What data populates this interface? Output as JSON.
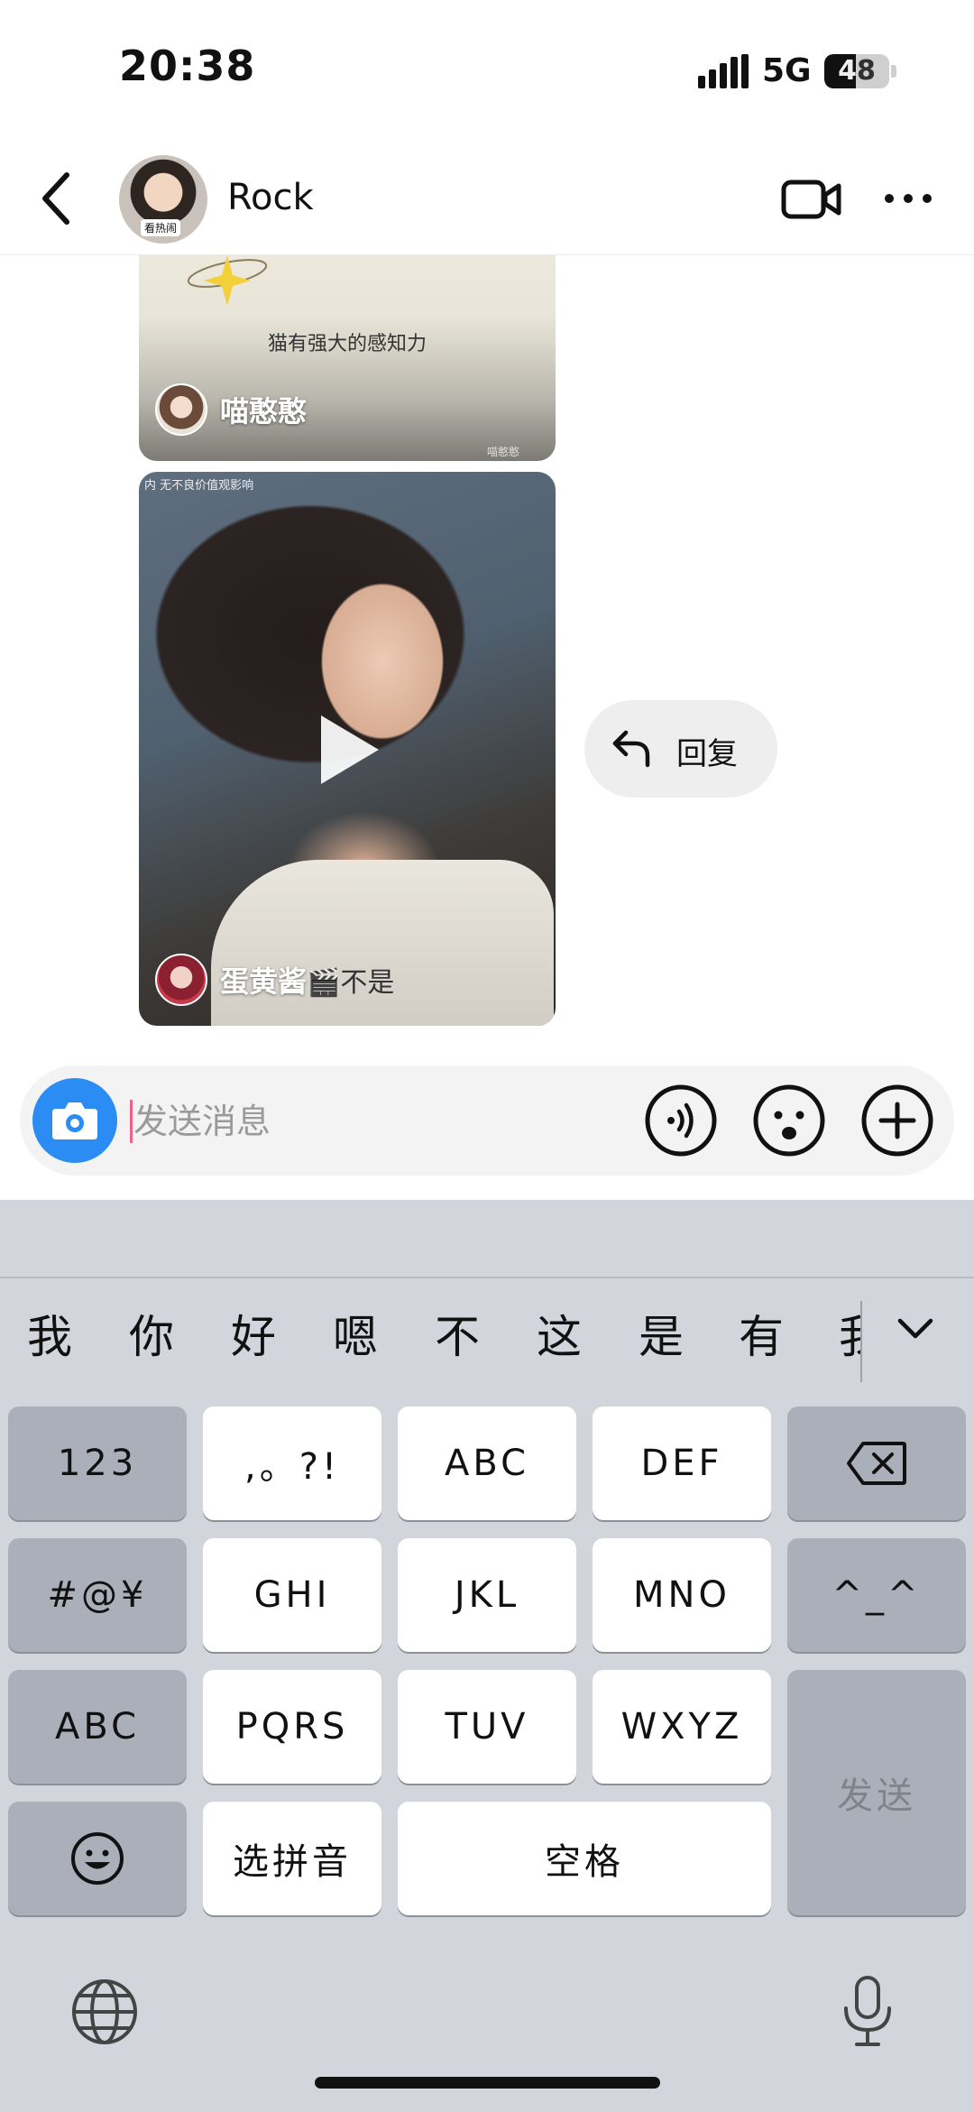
{
  "status_bar": {
    "time": "20:38",
    "network": "5G",
    "battery": "48",
    "battery_level": 0.48
  },
  "header": {
    "contact_name": "Rock",
    "avatar_tag": "看热闹"
  },
  "messages": [
    {
      "type": "video-card",
      "caption": "猫有强大的感知力",
      "author": "喵憨憨",
      "watermark": "喵憨憨"
    },
    {
      "type": "video-card",
      "notice": "内 无不良价值观影响",
      "author": "蛋黄酱",
      "author_suffix": "🎬不是"
    }
  ],
  "reply": {
    "label": "回复"
  },
  "composer": {
    "placeholder": "发送消息"
  },
  "keyboard": {
    "candidates": [
      "我",
      "你",
      "好",
      "嗯",
      "不",
      "这",
      "是",
      "有",
      "我"
    ],
    "rows": [
      [
        "123",
        ",。?!",
        "ABC",
        "DEF"
      ],
      [
        "#@¥",
        "GHI",
        "JKL",
        "MNO",
        "^_^"
      ],
      [
        "ABC",
        "PQRS",
        "TUV",
        "WXYZ"
      ],
      [
        "选拼音",
        "空格"
      ]
    ],
    "send_label": "发送"
  },
  "colors": {
    "accent": "#2b8df4",
    "caret": "#f0608a",
    "keyboard_bg": "#d2d5db"
  }
}
